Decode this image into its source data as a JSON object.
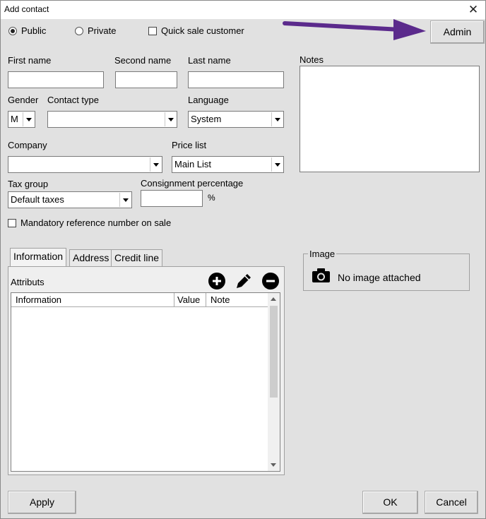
{
  "window": {
    "title": "Add contact",
    "close_label": "✕"
  },
  "visibility": {
    "public_label": "Public",
    "private_label": "Private",
    "quick_sale_label": "Quick sale customer",
    "selected": "Public"
  },
  "admin_button": "Admin",
  "fields": {
    "first_name": "First name",
    "second_name": "Second name",
    "last_name": "Last name",
    "notes": "Notes",
    "gender": {
      "label": "Gender",
      "value": "M"
    },
    "contact_type": {
      "label": "Contact type",
      "value": ""
    },
    "language": {
      "label": "Language",
      "value": "System"
    },
    "company": {
      "label": "Company",
      "value": ""
    },
    "price_list": {
      "label": "Price list",
      "value": "Main List"
    },
    "tax_group": {
      "label": "Tax group",
      "value": "Default taxes"
    },
    "consignment": {
      "label": "Consignment percentage",
      "unit": "%"
    },
    "mandatory_ref": "Mandatory reference number on sale"
  },
  "tabs": [
    "Information",
    "Address",
    "Credit line"
  ],
  "attributes": {
    "label": "Attributs",
    "columns": [
      "Information",
      "Value",
      "Note"
    ],
    "rows": []
  },
  "image": {
    "group_label": "Image",
    "status": "No image attached"
  },
  "footer": {
    "apply": "Apply",
    "ok": "OK",
    "cancel": "Cancel"
  },
  "colors": {
    "annotation_arrow": "#5b2a8c"
  }
}
